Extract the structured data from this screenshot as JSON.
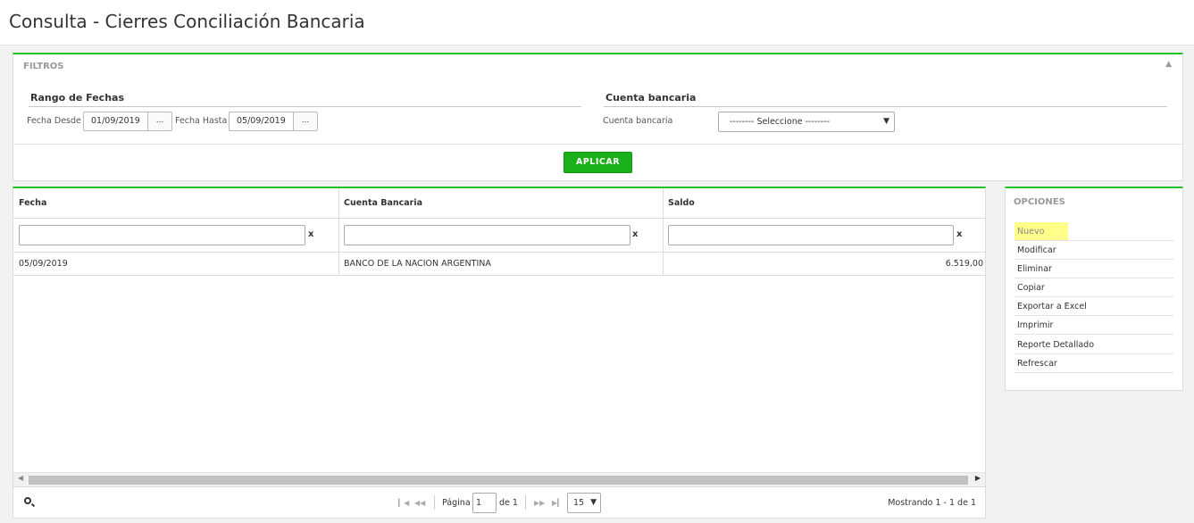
{
  "page": {
    "title": "Consulta - Cierres Conciliación Bancaria"
  },
  "filters": {
    "title": "FILTROS",
    "collapse_icon": "chevron-up-icon",
    "date_range": {
      "title": "Rango de Fechas",
      "from_label": "Fecha Desde",
      "from_value": "01/09/2019",
      "to_label": "Fecha Hasta",
      "to_value": "05/09/2019",
      "picker_label": "..."
    },
    "account": {
      "title": "Cuenta bancaria",
      "label": "Cuenta bancaria",
      "selected": "-------- Seleccione --------"
    },
    "apply_label": "APLICAR"
  },
  "grid": {
    "columns": [
      "Fecha",
      "Cuenta Bancaria",
      "Saldo"
    ],
    "clear_label": "x",
    "rows": [
      {
        "fecha": "05/09/2019",
        "cuenta": "BANCO DE LA NACION ARGENTINA",
        "saldo": "6.519,00"
      }
    ],
    "pager": {
      "page_label": "Página",
      "page_value": "1",
      "of_label": "de 1",
      "page_size": "15",
      "summary": "Mostrando 1 - 1 de 1"
    }
  },
  "options": {
    "title": "OPCIONES",
    "items": [
      "Nuevo",
      "Modificar",
      "Eliminar",
      "Copiar",
      "Exportar a Excel",
      "Imprimir",
      "Reporte Detallado",
      "Refrescar"
    ],
    "highlighted": "Nuevo",
    "highlight_color": "#ffff8a"
  },
  "colors": {
    "accent": "#22c128",
    "button": "#19b019"
  }
}
